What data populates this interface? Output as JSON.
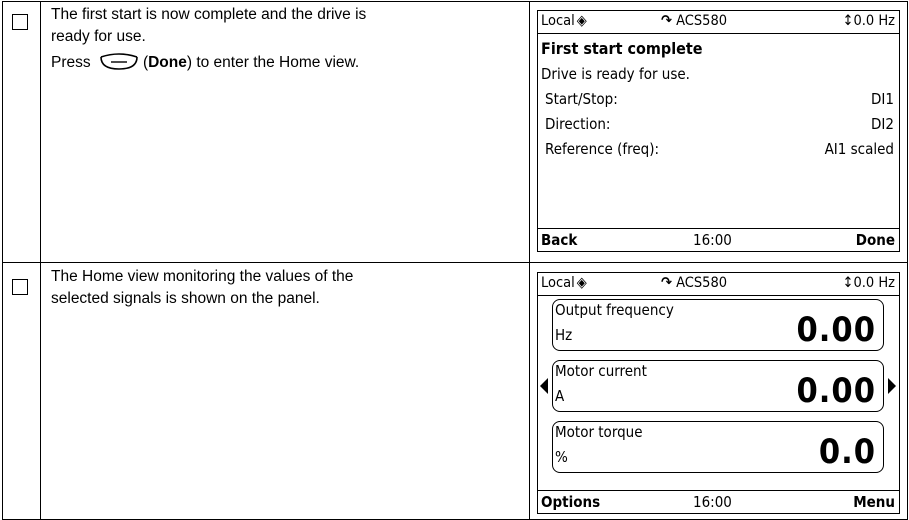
{
  "rows": [
    {
      "instruction_lines": [
        "The first start is now complete and the drive is",
        "ready for use."
      ],
      "press_prefix": "Press",
      "press_key_bold": "Done",
      "press_suffix": "to enter the Home view.",
      "panel": {
        "header": {
          "mode": "Local",
          "drive": "ACS580",
          "reference": "↕0.0 Hz"
        },
        "heading": "First start complete",
        "message": "Drive is ready for use.",
        "settings": [
          {
            "label": "Start/Stop:",
            "value": "DI1"
          },
          {
            "label": "Direction:",
            "value": "DI2"
          },
          {
            "label": "Reference (freq):",
            "value": "AI1 scaled"
          }
        ],
        "footer": {
          "left": "Back",
          "time": "16:00",
          "right": "Done"
        }
      }
    },
    {
      "instruction_lines": [
        "The Home view monitoring the values of the",
        "selected signals is shown on the panel."
      ],
      "panel": {
        "header": {
          "mode": "Local",
          "drive": "ACS580",
          "reference": "↕0.0 Hz"
        },
        "signals": [
          {
            "name": "Output frequency",
            "unit": "Hz",
            "value": "0.00"
          },
          {
            "name": "Motor current",
            "unit": "A",
            "value": "0.00"
          },
          {
            "name": "Motor torque",
            "unit": "%",
            "value": "0.0"
          }
        ],
        "footer": {
          "left": "Options",
          "time": "16:00",
          "right": "Menu"
        }
      }
    }
  ]
}
